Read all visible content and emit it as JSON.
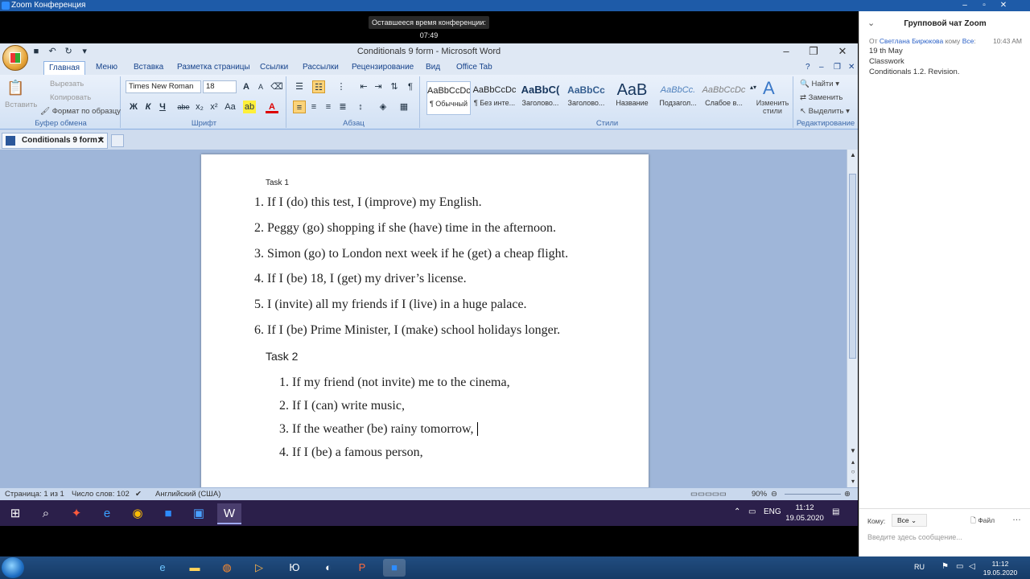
{
  "zoom": {
    "window_title": "Zoom Конференция",
    "timer": "Оставшееся время конференции: 07:49"
  },
  "word": {
    "title": "Conditionals 9 form - Microsoft Word",
    "tabs": [
      "Главная",
      "Меню",
      "Вставка",
      "Разметка страницы",
      "Ссылки",
      "Рассылки",
      "Рецензирование",
      "Вид",
      "Office Tab"
    ],
    "clipboard": {
      "paste": "Вставить",
      "cut": "Вырезать",
      "copy": "Копировать",
      "format_painter": "Формат по образцу",
      "label": "Буфер обмена"
    },
    "font": {
      "name": "Times New Roman",
      "size": "18",
      "label": "Шрифт",
      "bold": "Ж",
      "italic": "К",
      "underline": "Ч",
      "strike": "abe",
      "subscript": "x₂",
      "superscript": "x²",
      "case": "Aa",
      "grow": "A",
      "shrink": "A"
    },
    "paragraph": {
      "label": "Абзац"
    },
    "styles": {
      "label": "Стили",
      "items": [
        {
          "sample": "AaBbCcDc",
          "name": "¶ Обычный"
        },
        {
          "sample": "AaBbCcDc",
          "name": "¶ Без инте..."
        },
        {
          "sample": "AaBbC(",
          "name": "Заголово..."
        },
        {
          "sample": "AaBbCc",
          "name": "Заголово..."
        },
        {
          "sample": "AaB",
          "name": "Название"
        },
        {
          "sample": "AaBbCc.",
          "name": "Подзагол..."
        },
        {
          "sample": "AaBbCcDc",
          "name": "Слабое в..."
        }
      ],
      "change": "Изменить стили"
    },
    "editing": {
      "label": "Редактирование",
      "find": "Найти",
      "replace": "Заменить",
      "select": "Выделить"
    },
    "doc_tab": "Conditionals 9 form *",
    "document": {
      "task1_label": "Task 1",
      "task1": [
        "If I (do) this test, I (improve) my English.",
        "Peggy (go) shopping if she (have) time in the afternoon.",
        "Simon (go) to London next week if he (get) a cheap flight.",
        "If I (be) 18, I (get) my driver’s license.",
        "I (invite) all my friends if I (live) in a huge palace.",
        "If I (be) Prime Minister, I (make) school holidays longer."
      ],
      "task2_label": "Task 2",
      "task2": [
        "If my friend (not invite) me to the cinema,",
        "If  I (can) write music,",
        "If the weather (be) rainy tomorrow,",
        "If I (be) a famous person,"
      ]
    },
    "status": {
      "page": "Страница: 1 из 1",
      "words": "Число слов: 102",
      "language": "Английский (США)",
      "zoom": "90%"
    }
  },
  "chat": {
    "header": "Групповой чат Zoom",
    "from_prefix": "От",
    "sender": "Светлана Бирюкова",
    "to_text": "кому",
    "recipient": "Все",
    "time": "10:43 AM",
    "lines": [
      "19 th May",
      "Classwork",
      "Conditionals 1.2. Revision."
    ],
    "to_label": "Кому:",
    "to_value": "Все",
    "file": "Файл",
    "placeholder": "Введите здесь сообщение..."
  },
  "inner_taskbar": {
    "time": "11:12",
    "date": "19.05.2020",
    "lang": "ENG"
  },
  "outer_taskbar": {
    "lang": "RU",
    "time": "11:12",
    "date": "19.05.2020"
  }
}
